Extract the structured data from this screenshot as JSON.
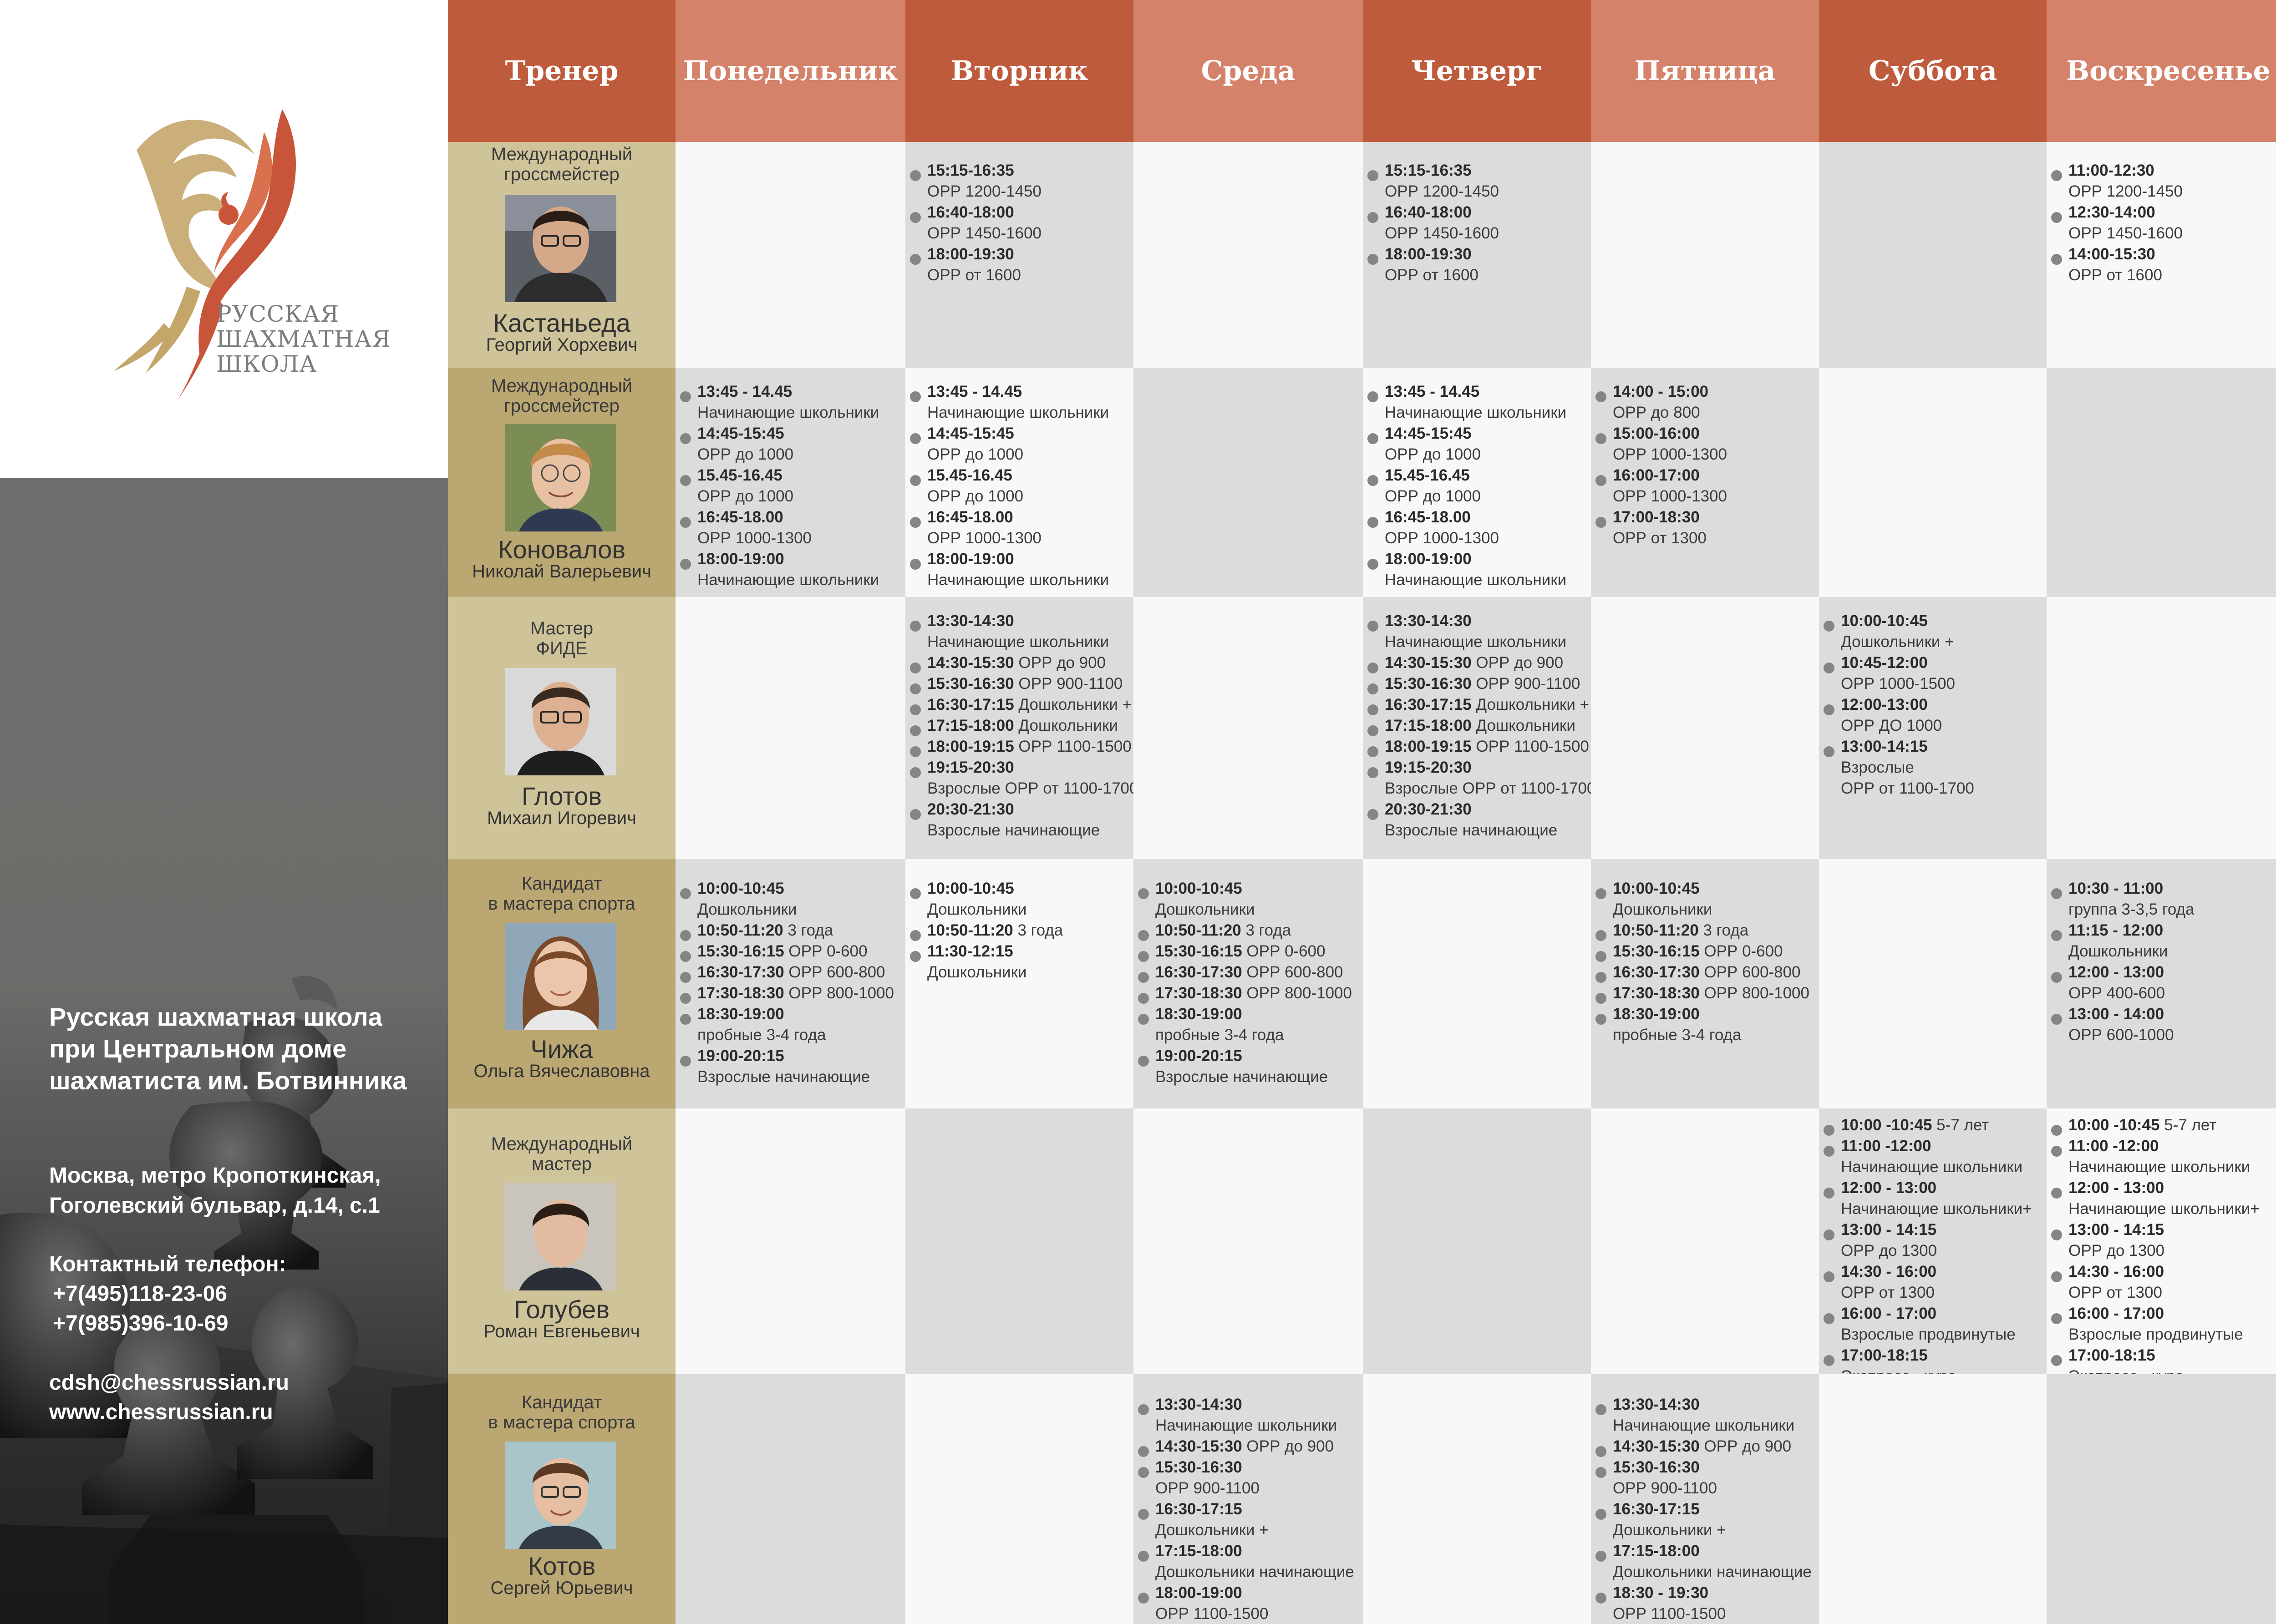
{
  "logo": {
    "line1": "РУССКАЯ",
    "line2": "ШАХМАТНАЯ",
    "line3": "ШКОЛА"
  },
  "school": {
    "line1": "Русская шахматная школа",
    "line2": "при Центральном доме",
    "line3": "шахматиста им. Ботвинника"
  },
  "contacts": {
    "address1": "Москва, метро Кропоткинская,",
    "address2": "Гоголевский бульвар, д.14, с.1",
    "phone_label": "Контактный телефон:",
    "phone1": "+7(495)118-23-06",
    "phone2": "+7(985)396-10-69",
    "email": "cdsh@chessrussian.ru",
    "site": "www.chessrussian.ru"
  },
  "colors": {
    "header_dark": "#bf5b3d",
    "header_light": "#d4826a",
    "trainer_light": "#cfc39a",
    "trainer_dark": "#bba772",
    "cell_grey": "#dcdcdc",
    "cell_white": "#f8f8f8",
    "logo_gold": "#c4a66b",
    "logo_red": "#c8553a"
  },
  "headers": [
    "Тренер",
    "Понедельник",
    "Вторник",
    "Среда",
    "Четверг",
    "Пятница",
    "Суббота",
    "Воскресенье"
  ],
  "trainers": [
    {
      "title": [
        "Международный",
        "гроссмейстер"
      ],
      "surname": "Кастаньеда",
      "name": "Георгий Хорхевич",
      "photo": "trainer-photo-1"
    },
    {
      "title": [
        "Международный",
        "гроссмейстер"
      ],
      "surname": "Коновалов",
      "name": "Николай Валерьевич",
      "photo": "trainer-photo-2"
    },
    {
      "title": [
        "Мастер",
        "ФИДЕ"
      ],
      "surname": "Глотов",
      "name": "Михаил Игоревич",
      "photo": "trainer-photo-3"
    },
    {
      "title": [
        "Кандидат",
        "в мастера спорта"
      ],
      "surname": "Чижа",
      "name": "Ольга Вячеславовна",
      "photo": "trainer-photo-4"
    },
    {
      "title": [
        "Международный",
        "мастер"
      ],
      "surname": "Голубев",
      "name": "Роман Евгеньевич",
      "photo": "trainer-photo-5"
    },
    {
      "title": [
        "Кандидат",
        "в мастера спорта"
      ],
      "surname": "Котов",
      "name": "Сергей Юрьевич",
      "photo": "trainer-photo-6"
    }
  ],
  "schedule": [
    [
      [],
      [
        [
          "15:15-16:35",
          ""
        ],
        [
          "",
          "ОРР 1200-1450"
        ],
        [
          "16:40-18:00",
          ""
        ],
        [
          "",
          "ОРР 1450-1600"
        ],
        [
          "18:00-19:30",
          ""
        ],
        [
          "",
          "ОРР от 1600"
        ]
      ],
      [],
      [
        [
          "15:15-16:35",
          ""
        ],
        [
          "",
          "ОРР 1200-1450"
        ],
        [
          "16:40-18:00",
          ""
        ],
        [
          "",
          "ОРР 1450-1600"
        ],
        [
          "18:00-19:30",
          ""
        ],
        [
          "",
          "ОРР от 1600"
        ]
      ],
      [],
      [],
      [
        [
          "11:00-12:30",
          ""
        ],
        [
          "",
          "ОРР 1200-1450"
        ],
        [
          "12:30-14:00",
          ""
        ],
        [
          "",
          "ОРР 1450-1600"
        ],
        [
          "14:00-15:30",
          ""
        ],
        [
          "",
          "ОРР от 1600"
        ]
      ]
    ],
    [
      [
        [
          "13:45 - 14.45",
          ""
        ],
        [
          "",
          "Начинающие школьники"
        ],
        [
          "14:45-15:45",
          ""
        ],
        [
          "",
          "ОРР до 1000"
        ],
        [
          "15.45-16.45",
          ""
        ],
        [
          "",
          "ОРР до 1000"
        ],
        [
          "16:45-18.00",
          ""
        ],
        [
          "",
          "ОРР 1000-1300"
        ],
        [
          "18:00-19:00",
          ""
        ],
        [
          "",
          "Начинающие школьники"
        ]
      ],
      [
        [
          "13:45 - 14.45",
          ""
        ],
        [
          "",
          "Начинающие школьники"
        ],
        [
          "14:45-15:45",
          ""
        ],
        [
          "",
          "ОРР до 1000"
        ],
        [
          "15.45-16.45",
          ""
        ],
        [
          "",
          "ОРР до 1000"
        ],
        [
          "16:45-18.00",
          ""
        ],
        [
          "",
          "ОРР 1000-1300"
        ],
        [
          "18:00-19:00",
          ""
        ],
        [
          "",
          "Начинающие школьники"
        ]
      ],
      [],
      [
        [
          "13:45 - 14.45",
          ""
        ],
        [
          "",
          "Начинающие школьники"
        ],
        [
          "14:45-15:45",
          ""
        ],
        [
          "",
          "ОРР до 1000"
        ],
        [
          "15.45-16.45",
          ""
        ],
        [
          "",
          "ОРР до 1000"
        ],
        [
          "16:45-18.00",
          ""
        ],
        [
          "",
          "ОРР 1000-1300"
        ],
        [
          "18:00-19:00",
          ""
        ],
        [
          "",
          "Начинающие школьники"
        ]
      ],
      [
        [
          "14:00 - 15:00",
          ""
        ],
        [
          "",
          "ОРР до 800"
        ],
        [
          "15:00-16:00",
          ""
        ],
        [
          "",
          "ОРР 1000-1300"
        ],
        [
          "16:00-17:00",
          ""
        ],
        [
          "",
          "ОРР 1000-1300"
        ],
        [
          "17:00-18:30",
          ""
        ],
        [
          "",
          "ОРР от 1300"
        ]
      ],
      [],
      []
    ],
    [
      [],
      [
        [
          "13:30-14:30",
          ""
        ],
        [
          "",
          "Начинающие школьники"
        ],
        [
          "14:30-15:30",
          " ОРР до 900"
        ],
        [
          "15:30-16:30",
          " ОРР 900-1100"
        ],
        [
          "16:30-17:15",
          " Дошкольники +"
        ],
        [
          "17:15-18:00",
          " Дошкольники"
        ],
        [
          "18:00-19:15",
          " ОРР 1100-1500"
        ],
        [
          "19:15-20:30",
          ""
        ],
        [
          "",
          "Взрослые ОРР от 1100-1700"
        ],
        [
          "20:30-21:30",
          ""
        ],
        [
          "",
          "Взрослые начинающие"
        ]
      ],
      [],
      [
        [
          "13:30-14:30",
          ""
        ],
        [
          "",
          "Начинающие школьники"
        ],
        [
          "14:30-15:30",
          " ОРР до 900"
        ],
        [
          "15:30-16:30",
          " ОРР 900-1100"
        ],
        [
          "16:30-17:15",
          " Дошкольники +"
        ],
        [
          "17:15-18:00",
          " Дошкольники"
        ],
        [
          "18:00-19:15",
          " ОРР 1100-1500"
        ],
        [
          "19:15-20:30",
          ""
        ],
        [
          "",
          "Взрослые ОРР от 1100-1700"
        ],
        [
          "20:30-21:30",
          ""
        ],
        [
          "",
          "Взрослые начинающие"
        ]
      ],
      [],
      [
        [
          "10:00-10:45",
          ""
        ],
        [
          "",
          "Дошкольники +"
        ],
        [
          "10:45-12:00",
          ""
        ],
        [
          "",
          "ОРР 1000-1500"
        ],
        [
          "12:00-13:00",
          ""
        ],
        [
          "",
          "ОРР ДО 1000"
        ],
        [
          "13:00-14:15",
          ""
        ],
        [
          "",
          "Взрослые"
        ],
        [
          "",
          "ОРР от 1100-1700"
        ]
      ],
      []
    ],
    [
      [
        [
          "10:00-10:45",
          ""
        ],
        [
          "",
          "Дошкольники"
        ],
        [
          "10:50-11:20",
          " 3 года"
        ],
        [
          "15:30-16:15",
          " ОРР 0-600"
        ],
        [
          "16:30-17:30",
          " ОРР 600-800"
        ],
        [
          "17:30-18:30",
          " ОРР 800-1000"
        ],
        [
          "18:30-19:00",
          ""
        ],
        [
          "",
          "пробные 3-4 года"
        ],
        [
          "19:00-20:15",
          ""
        ],
        [
          "",
          "Взрослые начинающие"
        ]
      ],
      [
        [
          "10:00-10:45",
          ""
        ],
        [
          "",
          "Дошкольники"
        ],
        [
          "10:50-11:20",
          " 3 года"
        ],
        [
          "11:30-12:15",
          ""
        ],
        [
          "",
          "Дошкольники"
        ]
      ],
      [
        [
          "10:00-10:45",
          ""
        ],
        [
          "",
          "Дошкольники"
        ],
        [
          "10:50-11:20",
          " 3 года"
        ],
        [
          "15:30-16:15",
          " ОРР 0-600"
        ],
        [
          "16:30-17:30",
          " ОРР 600-800"
        ],
        [
          "17:30-18:30",
          " ОРР 800-1000"
        ],
        [
          "18:30-19:00",
          ""
        ],
        [
          "",
          "пробные 3-4 года"
        ],
        [
          "19:00-20:15",
          ""
        ],
        [
          "",
          "Взрослые начинающие"
        ]
      ],
      [],
      [
        [
          "10:00-10:45",
          ""
        ],
        [
          "",
          "Дошкольники"
        ],
        [
          "10:50-11:20",
          " 3 года"
        ],
        [
          "15:30-16:15",
          " ОРР 0-600"
        ],
        [
          "16:30-17:30",
          " ОРР 600-800"
        ],
        [
          "17:30-18:30",
          " ОРР 800-1000"
        ],
        [
          "18:30-19:00",
          ""
        ],
        [
          "",
          "пробные 3-4 года"
        ]
      ],
      [],
      [
        [
          "10:30 - 11:00",
          ""
        ],
        [
          "",
          "группа 3-3,5 года"
        ],
        [
          "11:15 - 12:00",
          ""
        ],
        [
          "",
          "Дошкольники"
        ],
        [
          "12:00 - 13:00",
          ""
        ],
        [
          "",
          " ОРР 400-600"
        ],
        [
          "13:00 - 14:00",
          ""
        ],
        [
          "",
          "ОРР 600-1000"
        ]
      ]
    ],
    [
      [],
      [],
      [],
      [],
      [],
      [
        [
          "10:00 -10:45",
          " 5-7 лет"
        ],
        [
          "11:00 -12:00",
          ""
        ],
        [
          "",
          "Начинающие школьники"
        ],
        [
          "12:00 - 13:00",
          ""
        ],
        [
          "",
          "Начинающие школьники+"
        ],
        [
          "13:00 - 14:15",
          ""
        ],
        [
          "",
          "ОРР до 1300"
        ],
        [
          "14:30 - 16:00",
          ""
        ],
        [
          "",
          "ОРР от 1300"
        ],
        [
          "16:00 - 17:00",
          ""
        ],
        [
          "",
          "Взрослые продвинутые"
        ],
        [
          "17:00-18:15",
          ""
        ],
        [
          "",
          "Экспресс - курс"
        ]
      ],
      [
        [
          "10:00 -10:45",
          " 5-7 лет"
        ],
        [
          "11:00 -12:00",
          ""
        ],
        [
          "",
          "Начинающие школьники"
        ],
        [
          "12:00 - 13:00",
          ""
        ],
        [
          "",
          "Начинающие школьники+"
        ],
        [
          "13:00 - 14:15",
          ""
        ],
        [
          "",
          "ОРР до 1300"
        ],
        [
          "14:30 - 16:00",
          ""
        ],
        [
          "",
          "ОРР от 1300"
        ],
        [
          "16:00 - 17:00",
          ""
        ],
        [
          "",
          "Взрослые продвинутые"
        ],
        [
          "17:00-18:15",
          ""
        ],
        [
          "",
          "Экспресс - курс"
        ]
      ]
    ],
    [
      [],
      [],
      [
        [
          "13:30-14:30",
          ""
        ],
        [
          "",
          "Начинающие школьники"
        ],
        [
          "14:30-15:30",
          " ОРР до 900"
        ],
        [
          "15:30-16:30",
          ""
        ],
        [
          "",
          "ОРР 900-1100"
        ],
        [
          "16:30-17:15",
          ""
        ],
        [
          "",
          "Дошкольники +"
        ],
        [
          "17:15-18:00",
          ""
        ],
        [
          "",
          "Дошкольники начинающие"
        ],
        [
          "18:00-19:00",
          ""
        ],
        [
          "",
          "ОРР 1100-1500"
        ]
      ],
      [],
      [
        [
          "13:30-14:30",
          ""
        ],
        [
          "",
          "Начинающие школьники"
        ],
        [
          "14:30-15:30",
          " ОРР до 900"
        ],
        [
          "15:30-16:30",
          ""
        ],
        [
          "",
          "ОРР 900-1100"
        ],
        [
          "16:30-17:15",
          ""
        ],
        [
          "",
          "Дошкольники +"
        ],
        [
          "17:15-18:00",
          ""
        ],
        [
          "",
          "Дошкольники начинающие"
        ],
        [
          "18:30 - 19:30",
          ""
        ],
        [
          "",
          "ОРР 1100-1500"
        ]
      ],
      [],
      []
    ]
  ]
}
